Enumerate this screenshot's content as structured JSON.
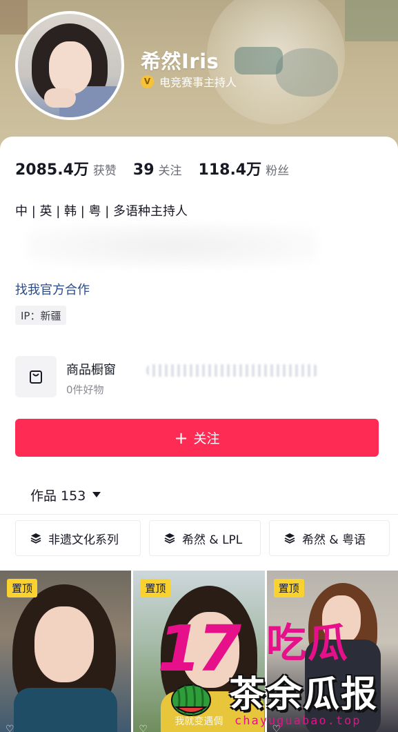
{
  "profile": {
    "name": "希然Iris",
    "verified_label": "电竞赛事主持人",
    "verified_badge": "V"
  },
  "stats": {
    "likes_value": "2085.4万",
    "likes_label": "获赞",
    "following_value": "39",
    "following_label": "关注",
    "followers_value": "118.4万",
    "followers_label": "粉丝"
  },
  "bio": "中 | 英 | 韩 | 粤 | 多语种主持人",
  "cooperation_link": "找我官方合作",
  "ip_tag": "IP：新疆",
  "shop": {
    "title": "商品橱窗",
    "subtitle": "0件好物"
  },
  "follow_button": {
    "icon": "+",
    "label": "关注"
  },
  "works": {
    "label": "作品 153"
  },
  "collections": [
    {
      "label": "非遗文化系列"
    },
    {
      "label": "希然 & LPL"
    },
    {
      "label": "希然 & 粤语"
    }
  ],
  "videos": [
    {
      "badge": "置顶",
      "caption": "",
      "likes": ""
    },
    {
      "badge": "置顶",
      "caption": "我就变遇倜",
      "likes": ""
    },
    {
      "badge": "置顶",
      "caption": "",
      "likes": ""
    }
  ],
  "watermark": {
    "number": "17",
    "brand_top": "吃瓜",
    "brand_main": "茶余瓜报",
    "url": "chayuguabao.top"
  },
  "colors": {
    "accent": "#fe2c55",
    "link": "#2a4a86",
    "pin_badge": "#f9d22f",
    "watermark_pink": "#e5108a"
  }
}
